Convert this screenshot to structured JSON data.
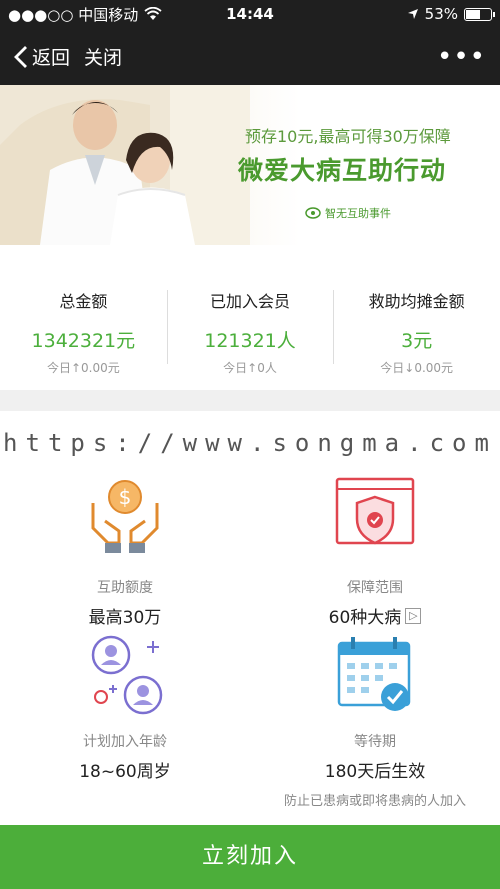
{
  "status_bar": {
    "carrier": "●●●○○ 中国移动",
    "time": "14:44",
    "battery": "53%"
  },
  "nav": {
    "back_label": "返回",
    "close_label": "关闭",
    "more_label": "•••"
  },
  "banner": {
    "subtitle": "预存10元,最高可得30万保障",
    "title": "微爱大病互助行动",
    "logo_text": "智无互助事件"
  },
  "stats": [
    {
      "label": "总金额",
      "value": "1342321元",
      "delta": "今日↑0.00元"
    },
    {
      "label": "已加入会员",
      "value": "121321人",
      "delta": "今日↑0人"
    },
    {
      "label": "救助均摊金额",
      "value": "3元",
      "delta": "今日↓0.00元"
    }
  ],
  "watermark": "https://www.songma.com",
  "features": [
    {
      "label": "互助额度",
      "value": "最高30万",
      "icon": "money-hands-icon"
    },
    {
      "label": "保障范围",
      "value": "60种大病",
      "icon": "shield-icon",
      "arrow": "▷"
    },
    {
      "label": "计划加入年龄",
      "value": "18~60周岁",
      "icon": "users-icon"
    },
    {
      "label": "等待期",
      "value": "180天后生效",
      "note": "防止已患病或即将患病的人加入",
      "icon": "calendar-check-icon"
    }
  ],
  "cta_label": "立刻加入",
  "colors": {
    "brand_green": "#4cae3a",
    "orange": "#f0a04b",
    "red": "#e0454f",
    "purple": "#7b6fd0",
    "blue": "#3aa0d8"
  }
}
